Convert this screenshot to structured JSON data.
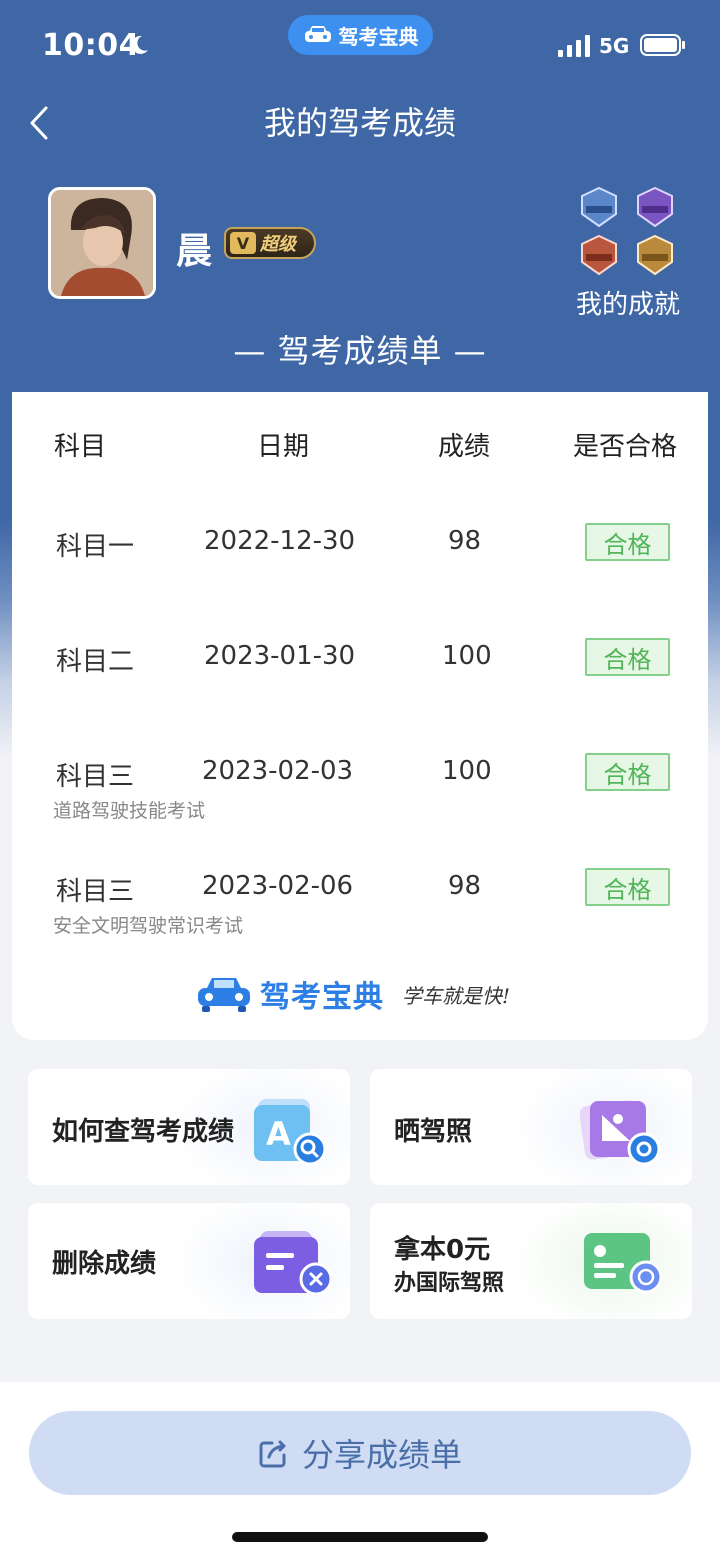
{
  "status_bar": {
    "time": "10:04",
    "network": "5G",
    "app_pill": "驾考宝典"
  },
  "nav": {
    "title": "我的驾考成绩"
  },
  "profile": {
    "name": "晨",
    "vip_letter": "V",
    "vip_label": "超级",
    "achievements_label": "我的成就"
  },
  "sheet": {
    "title": "— 驾考成绩单 —",
    "headers": [
      "科目",
      "日期",
      "成绩",
      "是否合格"
    ],
    "rows": [
      {
        "subject": "科目一",
        "date": "2022-12-30",
        "score": "98",
        "status": "合格",
        "note": ""
      },
      {
        "subject": "科目二",
        "date": "2023-01-30",
        "score": "100",
        "status": "合格",
        "note": ""
      },
      {
        "subject": "科目三",
        "date": "2023-02-03",
        "score": "100",
        "status": "合格",
        "note": "道路驾驶技能考试"
      },
      {
        "subject": "科目三",
        "date": "2023-02-06",
        "score": "98",
        "status": "合格",
        "note": "安全文明驾驶常识考试"
      }
    ],
    "brand_name": "驾考宝典",
    "brand_slogan": "学车就是快!"
  },
  "tiles": {
    "query": "如何查驾考成绩",
    "share_license": "晒驾照",
    "delete": "删除成绩",
    "intl_line1": "拿本0元",
    "intl_line2": "办国际驾照"
  },
  "share_button": "分享成绩单",
  "colors": {
    "header_blue": "#3f67a6",
    "pass_green": "#53b55a",
    "brand_blue": "#2d7fe6",
    "share_bg": "#cfdcf3"
  }
}
